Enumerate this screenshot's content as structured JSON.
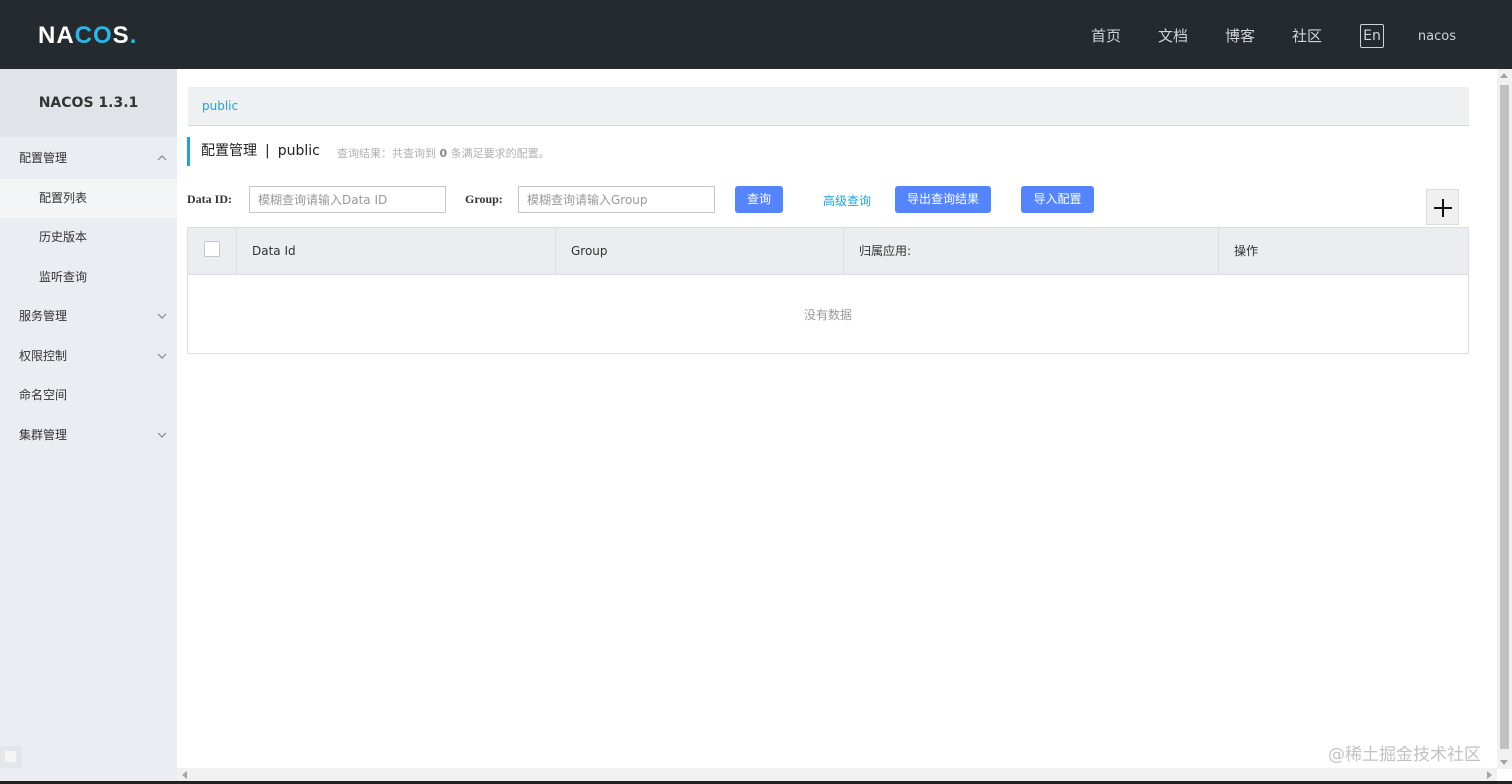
{
  "header": {
    "logo": {
      "part1": "NA",
      "part2": "CO",
      "part3": "S",
      "dot": "."
    },
    "nav": [
      "首页",
      "文档",
      "博客",
      "社区"
    ],
    "lang_button": "En",
    "username": "nacos"
  },
  "sidebar": {
    "version": "NACOS 1.3.1",
    "items": [
      {
        "label": "配置管理",
        "expanded": true
      },
      {
        "label": "配置列表",
        "sub": true,
        "active": true
      },
      {
        "label": "历史版本",
        "sub": true
      },
      {
        "label": "监听查询",
        "sub": true
      },
      {
        "label": "服务管理",
        "expanded": false
      },
      {
        "label": "权限控制",
        "expanded": false
      },
      {
        "label": "命名空间"
      },
      {
        "label": "集群管理",
        "expanded": false
      }
    ]
  },
  "namespace_bar": {
    "current": "public"
  },
  "page": {
    "title": "配置管理",
    "separator": "|",
    "namespace": "public",
    "result_prefix": "查询结果：共查询到",
    "result_count": "0",
    "result_suffix": "条满足要求的配置。"
  },
  "filters": {
    "data_id_label": "Data ID:",
    "data_id_placeholder": "模糊查询请输入Data ID",
    "group_label": "Group:",
    "group_placeholder": "模糊查询请输入Group",
    "search_button": "查询",
    "advanced_search": "高级查询",
    "export_button": "导出查询结果",
    "import_button": "导入配置"
  },
  "table": {
    "columns": [
      "Data Id",
      "Group",
      "归属应用:",
      "操作"
    ],
    "rows": [],
    "empty_text": "没有数据"
  },
  "watermark": "@稀土掘金技术社区",
  "colors": {
    "topbar": "#252a2f",
    "accent": "#1fa4d9",
    "primary_button": "#5584ff",
    "sidebar_bg": "#eaedf1"
  }
}
